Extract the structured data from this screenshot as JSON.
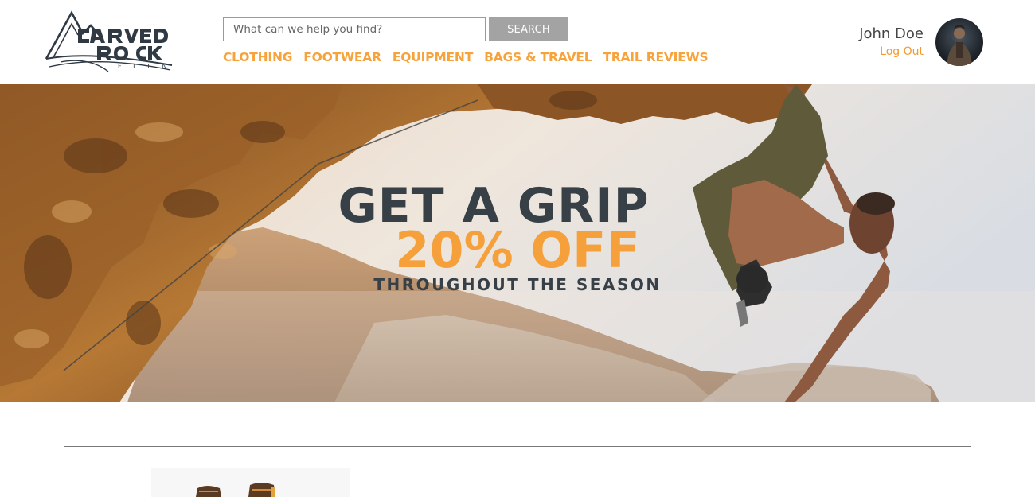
{
  "brand": {
    "logo_text": "CARVED ROCK",
    "logo_subtext": "FITNESS"
  },
  "search": {
    "placeholder": "What can we help you find?",
    "button_label": "SEARCH"
  },
  "nav": {
    "items": [
      {
        "label": "CLOTHING"
      },
      {
        "label": "FOOTWEAR"
      },
      {
        "label": "EQUIPMENT"
      },
      {
        "label": "BAGS & TRAVEL"
      },
      {
        "label": "TRAIL REVIEWS"
      }
    ]
  },
  "user": {
    "name": "John Doe",
    "logout_label": "Log Out"
  },
  "hero": {
    "title": "GET A GRIP",
    "discount": "20% OFF",
    "subtitle": "THROUGHOUT THE SEASON"
  },
  "colors": {
    "accent": "#f7a33c",
    "heading": "#384047",
    "search_button": "#a3a3a3"
  }
}
